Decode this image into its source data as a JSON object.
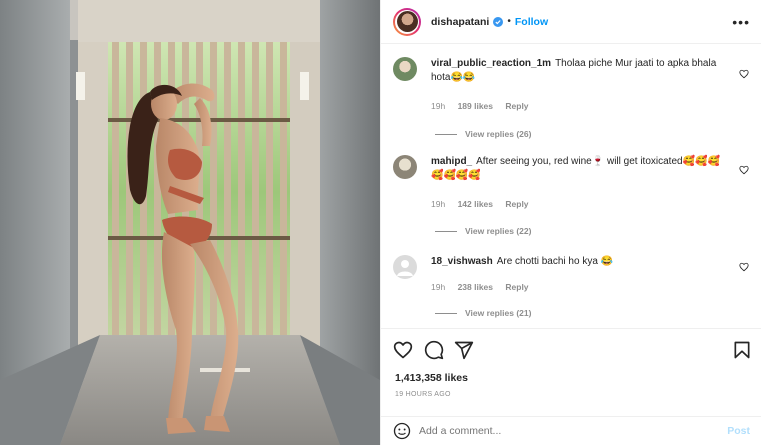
{
  "header": {
    "username": "dishapatani",
    "separator": "•",
    "follow_label": "Follow",
    "more_label": "•••"
  },
  "comments": [
    {
      "user": "viral_public_reaction_1m",
      "text": "Tholaa piche Mur jaati to apka bhala hota😂😂",
      "age": "19h",
      "likes": "189 likes",
      "reply_label": "Reply",
      "view_replies": "View replies (26)"
    },
    {
      "user": "mahipd_",
      "text": "After seeing you, red wine🍷 will get itoxicated🥰🥰🥰🥰🥰🥰🥰",
      "age": "19h",
      "likes": "142 likes",
      "reply_label": "Reply",
      "view_replies": "View replies (22)"
    },
    {
      "user": "18_vishwash",
      "text": "Are chotti bachi ho kya 😂",
      "age": "19h",
      "likes": "238 likes",
      "reply_label": "Reply",
      "view_replies": "View replies (21)"
    }
  ],
  "post": {
    "likes": "1,413,358 likes",
    "time": "19 HOURS AGO"
  },
  "add_comment": {
    "placeholder": "Add a comment...",
    "post_label": "Post"
  },
  "icons": {
    "like": "heart-icon",
    "comment": "comment-icon",
    "share": "paper-plane-icon",
    "save": "bookmark-icon",
    "emoji": "smiley-icon",
    "verified": "verified-badge-icon"
  },
  "colors": {
    "link_blue": "#0095f6",
    "muted": "#8e8e8e",
    "post_disabled": "#b2dffc"
  }
}
